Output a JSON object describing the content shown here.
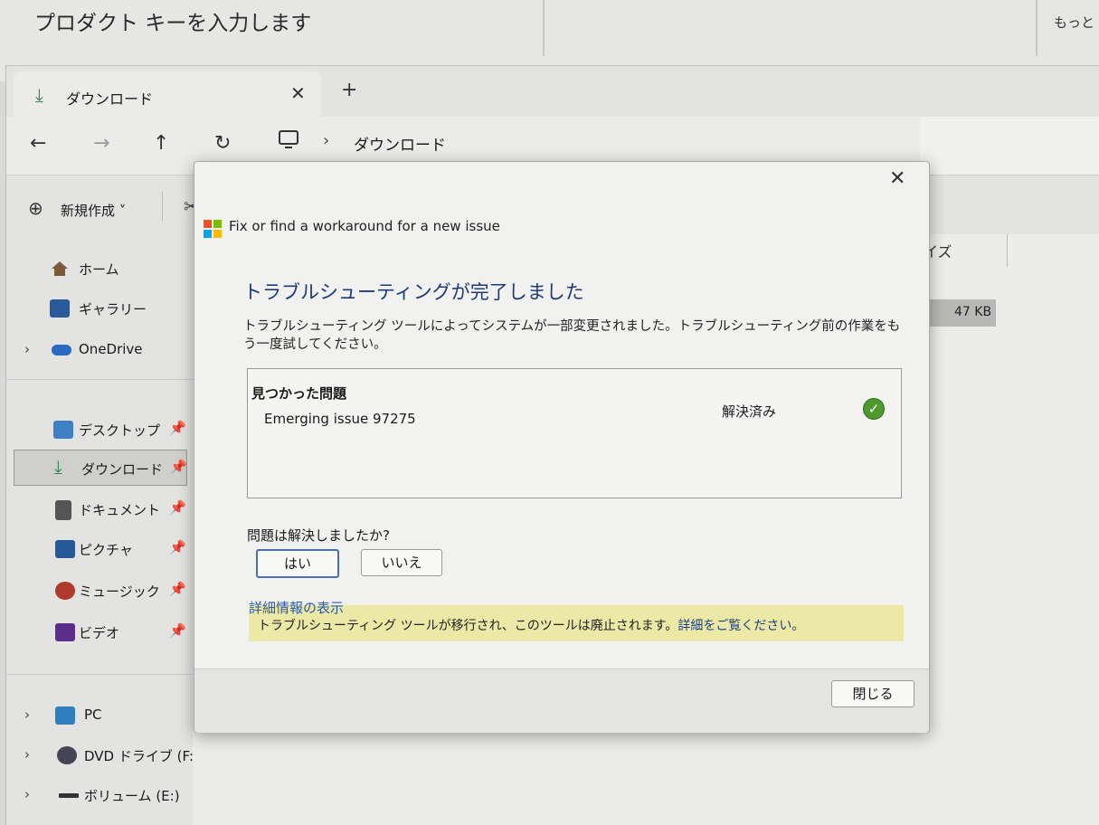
{
  "background": {
    "title": "プロダクト キーを入力します",
    "more_text": "もっと"
  },
  "explorer": {
    "tab_label": "ダウンロード",
    "new_tab_label": "+",
    "address_text": "ダウンロード",
    "command_new_label": "新規作成 ˅",
    "column_size_label": "イズ",
    "size_value": "47 KB",
    "sidebar_top": [
      {
        "label": "ホーム",
        "icon": "home-icon"
      },
      {
        "label": "ギャラリー",
        "icon": "gallery-icon"
      },
      {
        "label": "OneDrive",
        "icon": "onedrive-icon"
      }
    ],
    "sidebar_quick": [
      {
        "label": "デスクトップ",
        "icon": "desktop-icon"
      },
      {
        "label": "ダウンロード",
        "icon": "download-icon"
      },
      {
        "label": "ドキュメント",
        "icon": "document-icon"
      },
      {
        "label": "ピクチャ",
        "icon": "picture-icon"
      },
      {
        "label": "ミュージック",
        "icon": "music-icon"
      },
      {
        "label": "ビデオ",
        "icon": "video-icon"
      }
    ],
    "sidebar_bottom": [
      {
        "label": "PC",
        "icon": "pc-icon"
      },
      {
        "label": "DVD ドライブ (F:)",
        "icon": "dvd-drive-icon"
      },
      {
        "label": "ボリューム (E:)",
        "icon": "volume-icon"
      }
    ]
  },
  "dialog": {
    "app_title": "Fix or find a workaround for a new issue",
    "heading": "トラブルシューティングが完了しました",
    "description": "トラブルシューティング ツールによってシステムが一部変更されました。トラブルシューティング前の作業をもう一度試してください。",
    "issues_header": "見つかった問題",
    "issue_name": "Emerging issue 97275",
    "issue_status": "解決済み",
    "question": "問題は解決しましたか?",
    "yes_label": "はい",
    "no_label": "いいえ",
    "details_link": "詳細情報の表示",
    "notice_text": "トラブルシューティング ツールが移行され、このツールは廃止されます。",
    "notice_link": "詳細をご覧ください。",
    "close_label": "閉じる"
  },
  "colors": {
    "heading": "#1e3a78",
    "link": "#2a5bb0",
    "notice_bg": "#ece8a6",
    "check": "#4f9a2e"
  }
}
